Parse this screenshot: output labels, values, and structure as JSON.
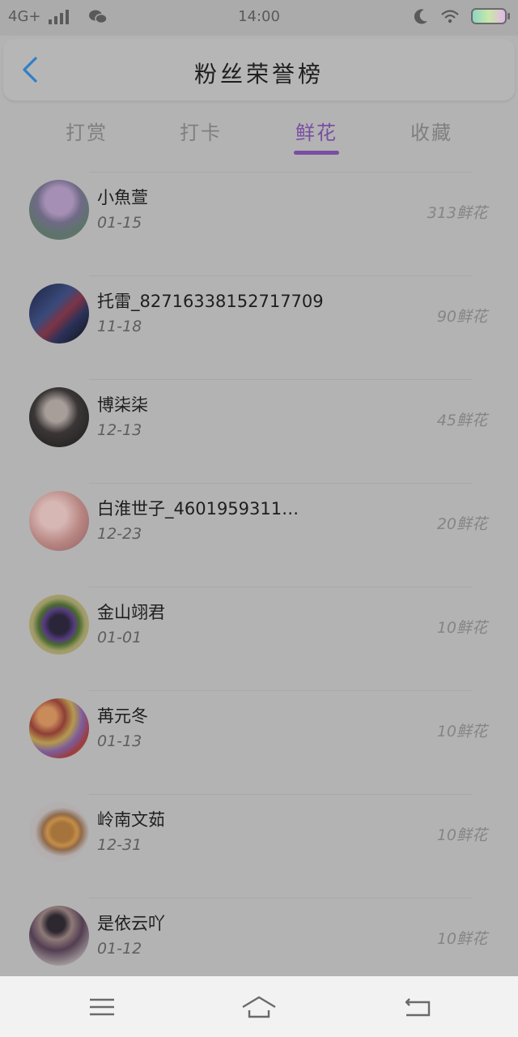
{
  "status_bar": {
    "network": "4G+",
    "time": "14:00",
    "icons": [
      "signal-icon",
      "wechat-icon",
      "moon-icon",
      "wifi-icon",
      "battery-icon"
    ]
  },
  "header": {
    "back_icon": "chevron-left-icon",
    "title": "粉丝荣誉榜"
  },
  "tabs": [
    {
      "label": "打赏",
      "active": false
    },
    {
      "label": "打卡",
      "active": false
    },
    {
      "label": "鲜花",
      "active": true
    },
    {
      "label": "收藏",
      "active": false
    }
  ],
  "fans": [
    {
      "name": "小魚萱",
      "date": "01-15",
      "amount": "313鲜花"
    },
    {
      "name": "托雷_82716338152717709",
      "date": "11-18",
      "amount": "90鲜花"
    },
    {
      "name": "博柒柒",
      "date": "12-13",
      "amount": "45鲜花"
    },
    {
      "name": "白淮世子_4601959311…",
      "date": "12-23",
      "amount": "20鲜花"
    },
    {
      "name": "金山翊君",
      "date": "01-01",
      "amount": "10鲜花"
    },
    {
      "name": "苒元冬",
      "date": "01-13",
      "amount": "10鲜花"
    },
    {
      "name": "岭南文茹",
      "date": "12-31",
      "amount": "10鲜花"
    },
    {
      "name": "是依云吖",
      "date": "01-12",
      "amount": "10鲜花"
    }
  ],
  "nav_bar": {
    "icons": [
      "menu-icon",
      "home-icon",
      "back-icon"
    ]
  },
  "colors": {
    "accent": "#7a4ea3",
    "back_arrow": "#2f7fc8",
    "overlay_background": "#b3b3b3"
  }
}
